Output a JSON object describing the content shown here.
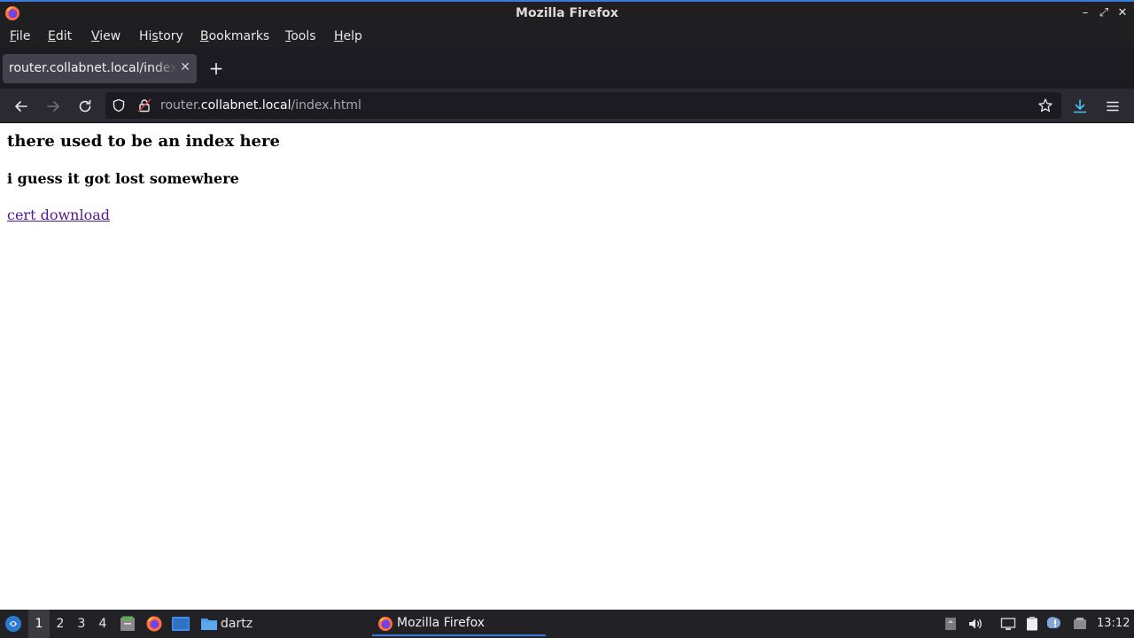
{
  "window": {
    "title": "Mozilla Firefox"
  },
  "menubar": {
    "items": [
      {
        "label": "File",
        "accel": "F",
        "rest": "ile"
      },
      {
        "label": "Edit",
        "accel": "E",
        "rest": "dit"
      },
      {
        "label": "View",
        "accel": "V",
        "rest": "iew"
      },
      {
        "label": "History",
        "pre": "Hi",
        "accel": "s",
        "rest": "tory"
      },
      {
        "label": "Bookmarks",
        "accel": "B",
        "rest": "ookmarks"
      },
      {
        "label": "Tools",
        "accel": "T",
        "rest": "ools"
      },
      {
        "label": "Help",
        "accel": "H",
        "rest": "elp"
      }
    ]
  },
  "tabs": [
    {
      "label": "router.collabnet.local/index.html",
      "active": true
    }
  ],
  "urlbar": {
    "prefix": "router.",
    "host": "collabnet.local",
    "path": "/index.html"
  },
  "page": {
    "heading": "there used to be an index here",
    "subheading": "i guess it got lost somewhere",
    "link": "cert download"
  },
  "taskbar": {
    "workspaces": [
      "1",
      "2",
      "3",
      "4"
    ],
    "active_workspace": "1",
    "folder_label": "dartz",
    "task_label": "Mozilla Firefox",
    "clock": "13:12"
  },
  "colors": {
    "accent": "#3b78d8",
    "download_icon": "#4cc3f0",
    "link_visited": "#551a8b"
  }
}
